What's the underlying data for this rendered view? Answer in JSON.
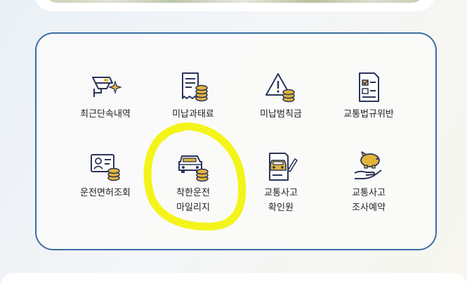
{
  "colors": {
    "panel_border": "#3b6ea5",
    "icon_navy": "#2c3559",
    "icon_gold": "#e2b53a",
    "highlight": "#f4f41a"
  },
  "menu": {
    "items": [
      {
        "id": "recent-enforcement",
        "icon": "cctv-camera-icon",
        "lines": [
          "최근단속내역"
        ]
      },
      {
        "id": "unpaid-fine",
        "icon": "receipt-coins-icon",
        "lines": [
          "미납과태료"
        ]
      },
      {
        "id": "unpaid-penalty",
        "icon": "warning-coins-icon",
        "lines": [
          "미납범칙금"
        ]
      },
      {
        "id": "traffic-violation",
        "icon": "checklist-document-icon",
        "lines": [
          "교통법규위반"
        ]
      },
      {
        "id": "license-lookup",
        "icon": "id-card-coins-icon",
        "lines": [
          "운전면허조회"
        ]
      },
      {
        "id": "safe-driving-mileage",
        "icon": "car-coins-icon",
        "lines": [
          "착한운전",
          "마일리지"
        ]
      },
      {
        "id": "accident-confirmation",
        "icon": "accident-report-icon",
        "lines": [
          "교통사고",
          "확인원"
        ]
      },
      {
        "id": "accident-investigation",
        "icon": "piggy-bank-hand-icon",
        "lines": [
          "교통사고",
          "조사예약"
        ]
      }
    ]
  }
}
